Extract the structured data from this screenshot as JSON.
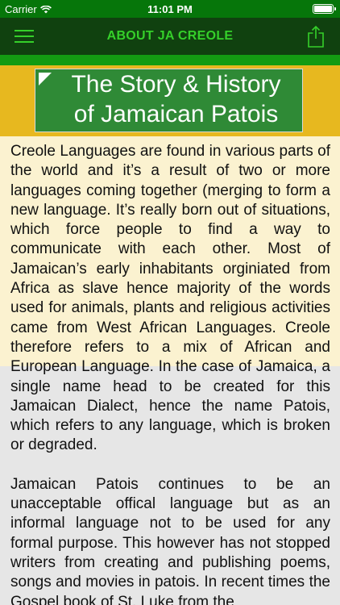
{
  "status_bar": {
    "carrier": "Carrier",
    "time": "11:01 PM",
    "signal_icon": "wifi-icon",
    "battery_icon": "battery-icon"
  },
  "nav": {
    "title": "ABOUT JA CREOLE",
    "menu_icon": "hamburger-menu-icon",
    "share_icon": "share-icon"
  },
  "header_banner": {
    "title_line1": "The Story & History",
    "title_line2": "of Jamaican Patois"
  },
  "colors": {
    "status_bar": "#06760a",
    "nav_bar": "#10410f",
    "nav_text": "#35d02a",
    "green_strip": "#139b12",
    "yellow_band": "#e7b81f",
    "title_box": "#2f8a36",
    "cream_background": "#fbf2d0",
    "page_background": "#e6e6e6"
  },
  "article": {
    "paragraph1": "Creole Languages are found in various parts of the world and it’s a result of two or more languages coming together (merging to form a new language. It’s really born out of situations, which force people to find a way to communicate with each other. Most of Jamaican’s early inhabitants orginiated from Africa as slave hence majority of the words used for animals, plants and religious activities came from West African Languages. Creole therefore refers to a mix of African and European Language. In the case of Jamaica, a single name head to be created for this Jamaican Dialect, hence the name Patois, which refers to any language, which is broken or degraded.",
    "paragraph2": "Jamaican Patois continues to be an unacceptable offical language but as an informal language not to be used for any formal purpose. This however has not stopped writers from creating and publishing poems, songs and movies in patois. In recent times the Gospel book of St. Luke from the"
  }
}
